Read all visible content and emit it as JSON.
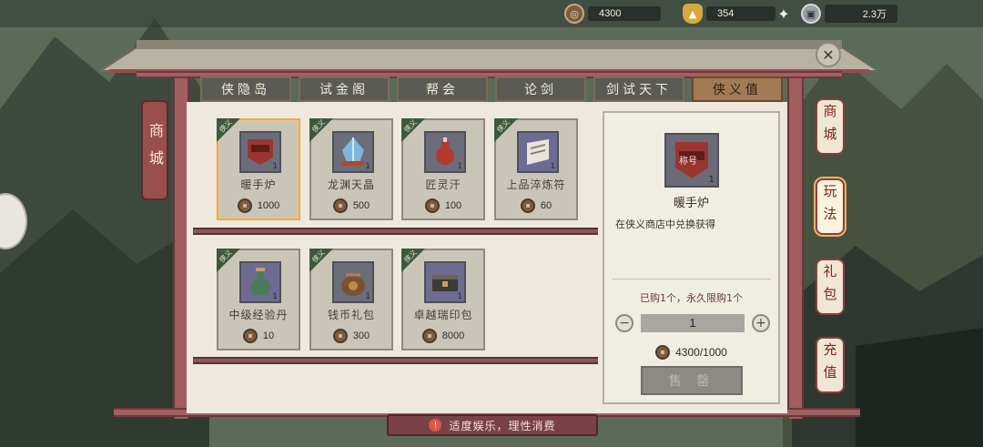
{
  "currency": {
    "coins": "4300",
    "ingots": "354",
    "cash": "2.3万"
  },
  "tabs": [
    {
      "label": "侠隐岛",
      "active": false
    },
    {
      "label": "试金阁",
      "active": false
    },
    {
      "label": "帮会",
      "active": false
    },
    {
      "label": "论剑",
      "active": false
    },
    {
      "label": "剑试天下",
      "active": false
    },
    {
      "label": "侠义值",
      "active": true
    }
  ],
  "left_sign": "商城",
  "items": [
    {
      "name": "暖手炉",
      "price": "1000",
      "tag": "侠义",
      "qty": "1",
      "selected": true,
      "icon": "banner-icon"
    },
    {
      "name": "龙渊天晶",
      "price": "500",
      "tag": "侠义",
      "qty": "1",
      "selected": false,
      "icon": "crystal-icon"
    },
    {
      "name": "匠灵汗",
      "price": "100",
      "tag": "侠义",
      "qty": "1",
      "selected": false,
      "icon": "gourd-icon"
    },
    {
      "name": "上品淬炼符",
      "price": "60",
      "tag": "侠义",
      "qty": "1",
      "selected": false,
      "icon": "talisman-icon"
    },
    {
      "name": "中级经验丹",
      "price": "10",
      "tag": "侠义",
      "qty": "1",
      "selected": false,
      "icon": "bottle-icon"
    },
    {
      "name": "钱币礼包",
      "price": "300",
      "tag": "侠义",
      "qty": "1",
      "selected": false,
      "icon": "pouch-icon"
    },
    {
      "name": "卓越瑞印包",
      "price": "8000",
      "tag": "侠义",
      "qty": "1",
      "selected": false,
      "icon": "chest-icon"
    }
  ],
  "detail": {
    "name": "暖手炉",
    "qty": "1",
    "badge": "称号",
    "description": "在侠义商店中兑换获得",
    "limit_text": "已购1个，永久限购1个",
    "quantity": "1",
    "cost": "4300/1000",
    "sell_label": "售 罄"
  },
  "right_tabs": [
    {
      "label": "商城",
      "active": false
    },
    {
      "label": "玩法",
      "active": true
    },
    {
      "label": "礼包",
      "active": false
    },
    {
      "label": "充值",
      "active": false
    }
  ],
  "notice": "适度娱乐，理性消费",
  "colors": {
    "frame": "#a25d5e",
    "panel": "#eee9dc",
    "selected_border": "#e3a95b",
    "tab_active": "#a07b54"
  }
}
